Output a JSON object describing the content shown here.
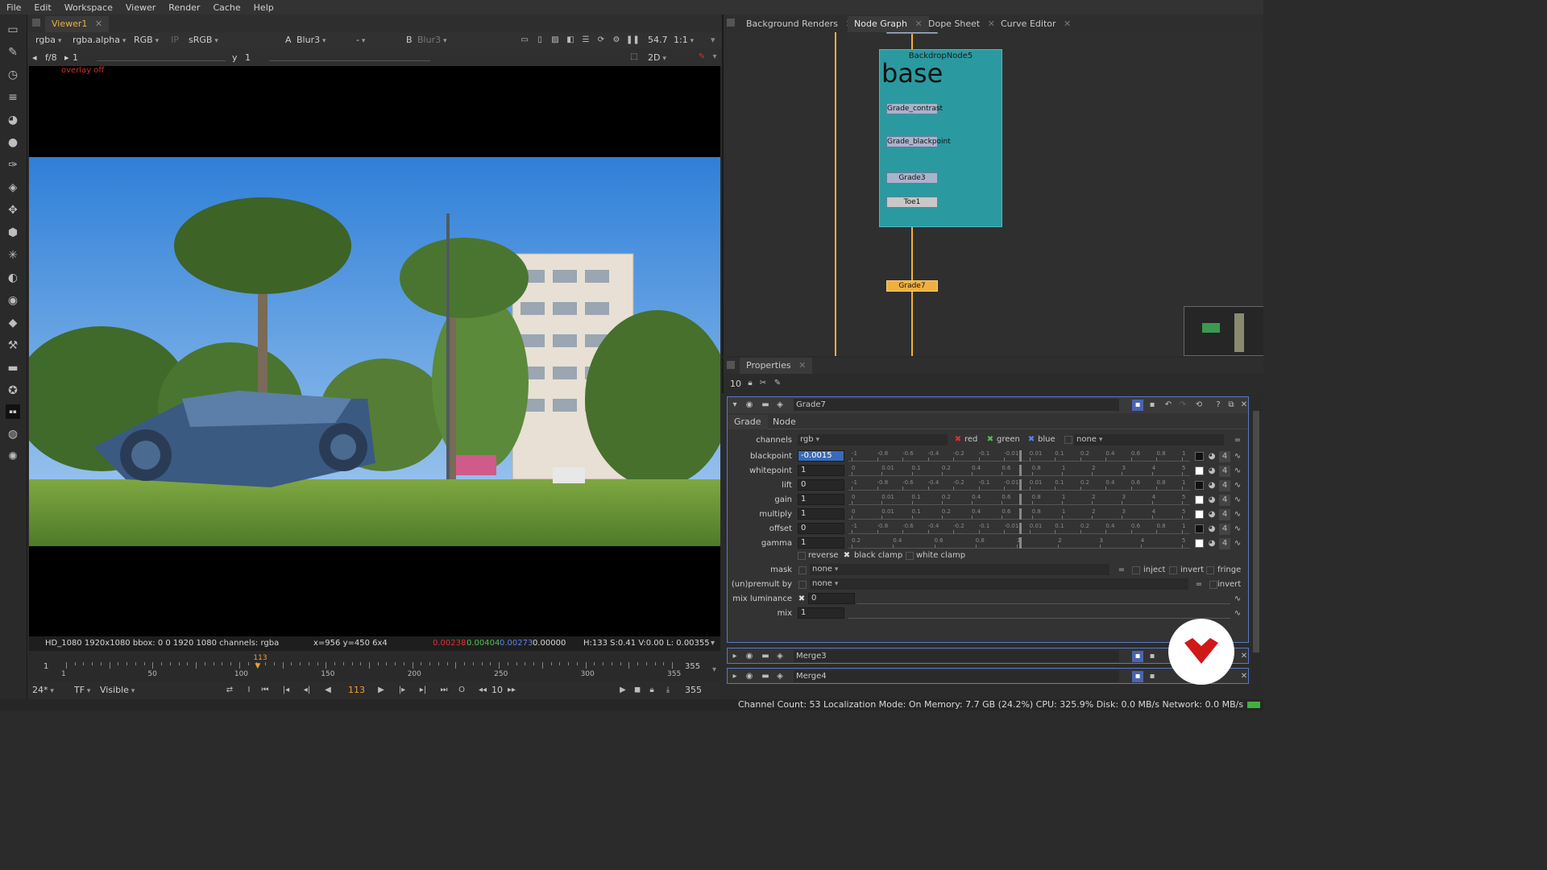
{
  "menu": [
    "File",
    "Edit",
    "Workspace",
    "Viewer",
    "Render",
    "Cache",
    "Help"
  ],
  "viewer": {
    "tab_label": "Viewer1",
    "toolbar": {
      "channels": "rgba",
      "alpha": "rgba.alpha",
      "colorspace_mode": "RGB",
      "lut": "sRGB",
      "input_a_label": "A",
      "input_a": "Blur3",
      "input_op": "-",
      "input_b_label": "B",
      "input_b": "Blur3",
      "zoom": "54.7",
      "ratio": "1:1"
    },
    "toolbar2": {
      "fstop": "f/8",
      "gain_value": "1",
      "gamma_label": "y",
      "gamma_value": "1",
      "view_mode": "2D"
    },
    "overlay_text": "overlay off",
    "info": {
      "format": "HD_1080 1920x1080  bbox: 0 0 1920 1080 channels: rgba",
      "coords": "x=956 y=450 6x4",
      "r": "0.00238",
      "g": "0.00404",
      "b": "0.00273",
      "a": "0.00000",
      "hsvl": "H:133 S:0.41 V:0.00  L: 0.00355"
    },
    "timeline": {
      "start": "1",
      "end": "355",
      "current": "113",
      "ticks": [
        "1",
        "50",
        "100",
        "150",
        "200",
        "250",
        "300",
        "355"
      ],
      "current_fraction": 0.317
    },
    "playback": {
      "fps": "24*",
      "tf": "TF",
      "visible": "Visible",
      "frame": "113",
      "step": "10",
      "end_frame": "355"
    },
    "colors": {
      "r": "#e03030",
      "g": "#50c050",
      "b": "#4060e0"
    }
  },
  "right_tabs": [
    {
      "label": "Background Renders"
    },
    {
      "label": "Node Graph"
    },
    {
      "label": "Dope Sheet"
    },
    {
      "label": "Curve Editor"
    }
  ],
  "node_graph": {
    "backdrop_label": "BackdropNode5",
    "backdrop_text": "base",
    "nodes": [
      "Grade_contrast",
      "Grade_blackpoint",
      "Grade3",
      "Toe1",
      "Grade7"
    ]
  },
  "properties": {
    "tab_label": "Properties",
    "max_panels": "10",
    "node_name": "Grade7",
    "tabs": [
      "Grade",
      "Node"
    ],
    "channels_label": "channels",
    "channels_value": "rgb",
    "channel_red": "red",
    "channel_green": "green",
    "channel_blue": "blue",
    "channel_extra": "none",
    "params": [
      {
        "label": "blackpoint",
        "value": "-0.0015",
        "ticks": [
          "-1",
          "-0.8",
          "-0.6",
          "-0.4",
          "-0.2",
          "-0.1",
          "-0.01",
          "0.01",
          "0.1",
          "0.2",
          "0.4",
          "0.6",
          "0.8",
          "1"
        ]
      },
      {
        "label": "whitepoint",
        "value": "1",
        "ticks": [
          "0",
          "0.01",
          "0.1",
          "0.2",
          "0.4",
          "0.6",
          "0.8",
          "1",
          "2",
          "3",
          "4",
          "5"
        ]
      },
      {
        "label": "lift",
        "value": "0",
        "ticks": [
          "-1",
          "-0.8",
          "-0.6",
          "-0.4",
          "-0.2",
          "-0.1",
          "-0.01",
          "0.01",
          "0.1",
          "0.2",
          "0.4",
          "0.6",
          "0.8",
          "1"
        ]
      },
      {
        "label": "gain",
        "value": "1",
        "ticks": [
          "0",
          "0.01",
          "0.1",
          "0.2",
          "0.4",
          "0.6",
          "0.8",
          "1",
          "2",
          "3",
          "4",
          "5"
        ]
      },
      {
        "label": "multiply",
        "value": "1",
        "ticks": [
          "0",
          "0.01",
          "0.1",
          "0.2",
          "0.4",
          "0.6",
          "0.8",
          "1",
          "2",
          "3",
          "4",
          "5"
        ]
      },
      {
        "label": "offset",
        "value": "0",
        "ticks": [
          "-1",
          "-0.8",
          "-0.6",
          "-0.4",
          "-0.2",
          "-0.1",
          "-0.01",
          "0.01",
          "0.1",
          "0.2",
          "0.4",
          "0.6",
          "0.8",
          "1"
        ]
      },
      {
        "label": "gamma",
        "value": "1",
        "ticks": [
          "0.2",
          "0.4",
          "0.6",
          "0.8",
          "1",
          "2",
          "3",
          "4",
          "5"
        ]
      }
    ],
    "swatch_label": "4",
    "reverse": "reverse",
    "black_clamp": "black clamp",
    "white_clamp": "white clamp",
    "mask_label": "mask",
    "mask_value": "none",
    "inject": "inject",
    "invert": "invert",
    "fringe": "fringe",
    "premult_label": "(un)premult by",
    "premult_value": "none",
    "premult_invert": "invert",
    "mix_lum_label": "mix luminance",
    "mix_lum_value": "0",
    "mix_label": "mix",
    "mix_value": "1",
    "collapsed_panels": [
      "Merge3",
      "Merge4"
    ]
  },
  "status": "Channel Count: 53  Localization Mode: On  Memory: 7.7 GB (24.2%)  CPU: 325.9%  Disk: 0.0 MB/s  Network: 0.0 MB/s"
}
